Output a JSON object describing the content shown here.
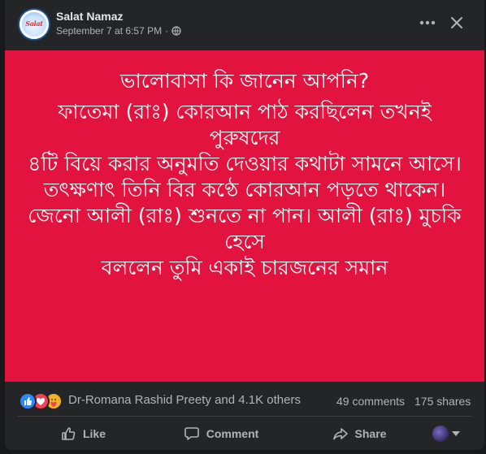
{
  "post": {
    "page_name": "Salat Namaz",
    "timestamp": "September 7 at 6:57 PM",
    "separator": "·",
    "avatar_text": "Salat",
    "media_bg": "#e2143f",
    "text": {
      "title": "ভালোবাসা কি জানেন আপনি?",
      "lines": [
        "ফাতেমা (রাঃ) কোরআন পাঠ করছিলেন তখনই পুরুষদের",
        "৪টি বিয়ে করার অনুমতি দেওয়ার কথাটা সামনে আসে।",
        "তৎক্ষণাৎ তিনি বির কণ্ঠে কোরআন পড়তে থাকেন।",
        "জেনো আলী (রাঃ) শুনতে না পান। আলী (রাঃ) মুচকি",
        "হেসে",
        "বললেন তুমি একাই চারজনের সমান"
      ]
    }
  },
  "engagement": {
    "reactors": "Dr-Romana Rashid Preety and 4.1K others",
    "comments": "49 comments",
    "shares": "175 shares"
  },
  "actions": {
    "like": "Like",
    "comment": "Comment",
    "share": "Share"
  },
  "colors": {
    "background": "#18191a",
    "card": "#242526",
    "like_blue": "#2d88ff",
    "love_red": "#f33e58",
    "care_yellow": "#f7b125",
    "secondary_text": "#b0b3b8"
  }
}
